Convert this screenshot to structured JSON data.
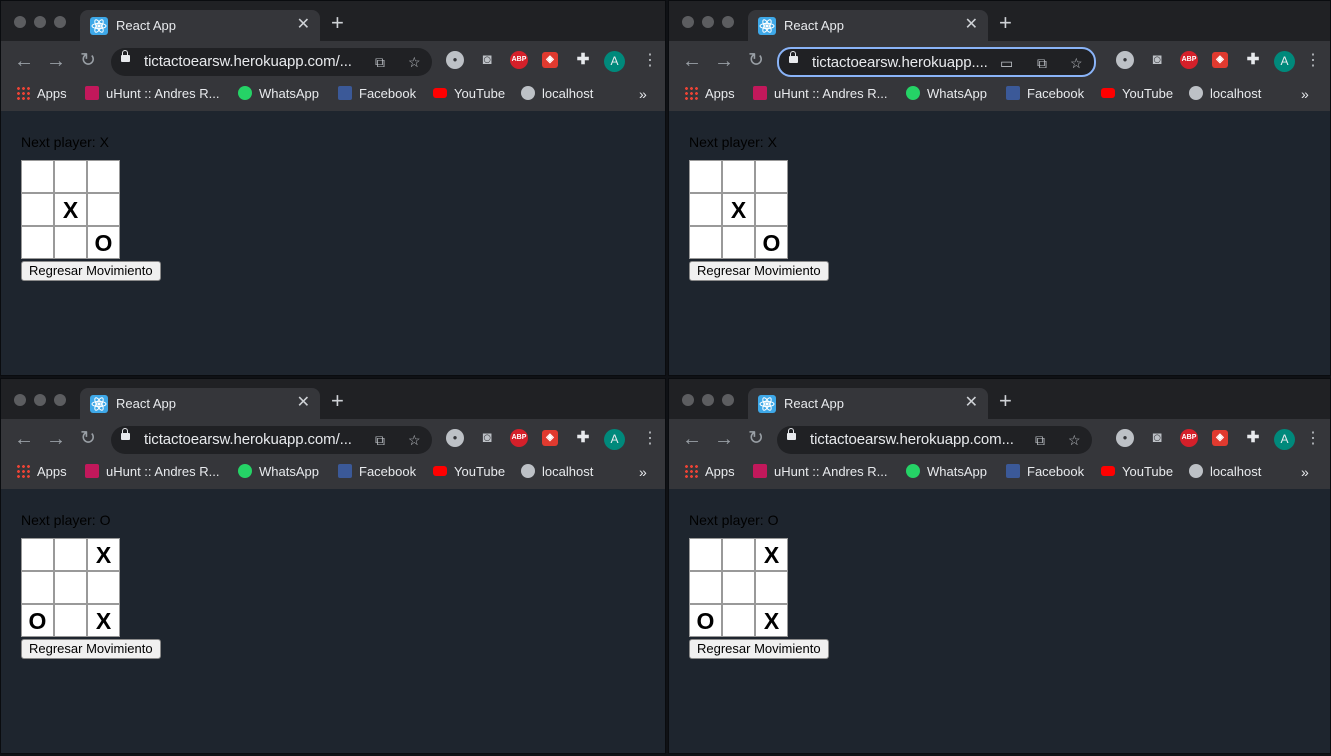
{
  "windows": [
    {
      "tab_title": "React App",
      "url": "tictactoearsw.herokuapp.com/...",
      "omnibox_focused": false,
      "status": "Next player: X",
      "board": [
        "",
        "",
        "",
        "",
        "X",
        "",
        "",
        "",
        "O"
      ],
      "undo_label": "Regresar Movimiento"
    },
    {
      "tab_title": "React App",
      "url": "tictactoearsw.herokuapp....",
      "omnibox_focused": true,
      "status": "Next player: X",
      "board": [
        "",
        "",
        "",
        "",
        "X",
        "",
        "",
        "",
        "O"
      ],
      "undo_label": "Regresar Movimiento"
    },
    {
      "tab_title": "React App",
      "url": "tictactoearsw.herokuapp.com/...",
      "omnibox_focused": false,
      "status": "Next player: O",
      "board": [
        "",
        "",
        "X",
        "",
        "",
        "",
        "O",
        "",
        "X"
      ],
      "undo_label": "Regresar Movimiento"
    },
    {
      "tab_title": "React App",
      "url": "tictactoearsw.herokuapp.com...",
      "omnibox_focused": false,
      "status": "Next player: O",
      "board": [
        "",
        "",
        "X",
        "",
        "",
        "",
        "O",
        "",
        "X"
      ],
      "undo_label": "Regresar Movimiento"
    }
  ],
  "bookmarks": [
    {
      "label": "Apps",
      "icon": "apps-grid-icon"
    },
    {
      "label": "uHunt :: Andres R...",
      "icon": "uhunt-icon"
    },
    {
      "label": "WhatsApp",
      "icon": "whatsapp-icon"
    },
    {
      "label": "Facebook",
      "icon": "facebook-icon"
    },
    {
      "label": "YouTube",
      "icon": "youtube-icon"
    },
    {
      "label": "localhost",
      "icon": "globe-icon"
    }
  ],
  "profile_initial": "A",
  "extensions": {
    "abp": "ABP"
  },
  "colors": {
    "page_background": "#1e252e",
    "toolbar": "#35363a",
    "tabstrip": "#202124",
    "focus_ring": "#8ab4f8",
    "avatar": "#00897b"
  }
}
